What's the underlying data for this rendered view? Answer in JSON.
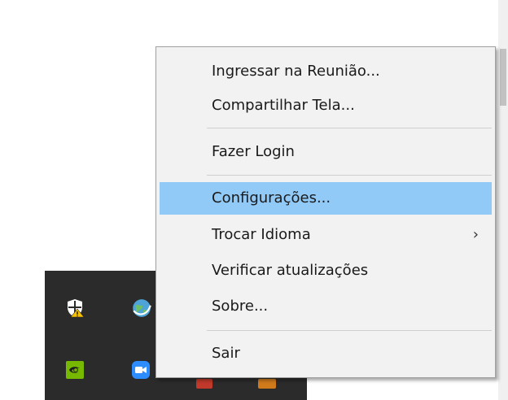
{
  "context_menu": {
    "items": [
      {
        "label": "Ingressar na Reunião..."
      },
      {
        "label": "Compartilhar Tela..."
      },
      {
        "label": "Fazer Login"
      },
      {
        "label": "Configurações...",
        "highlighted": true
      },
      {
        "label": "Trocar Idioma",
        "has_submenu": true,
        "submenu_glyph": "›"
      },
      {
        "label": "Verificar atualizações"
      },
      {
        "label": "Sobre..."
      },
      {
        "label": "Sair"
      }
    ],
    "highlight_color": "#91c9f7"
  },
  "system_tray": {
    "icons": [
      "windows-security-warning-icon",
      "globe-network-icon",
      "nvidia-icon",
      "zoom-icon",
      "tray-app-red-icon",
      "tray-app-orange-icon"
    ],
    "background_color": "#2b2b2b"
  }
}
